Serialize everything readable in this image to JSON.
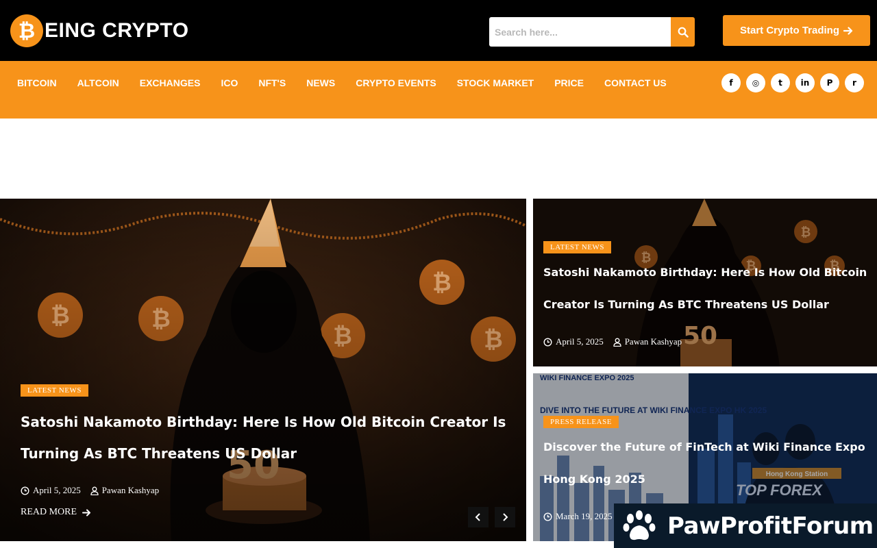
{
  "brand": {
    "logo_mark": "₿",
    "logo_text": "EING CRYPTO"
  },
  "search": {
    "placeholder": "Search here..."
  },
  "cta": {
    "label": "Start Crypto Trading",
    "icon": "arrow-right-icon"
  },
  "nav": {
    "items": [
      "BITCOIN",
      "ALTCOIN",
      "EXCHANGES",
      "ICO",
      "NFT'S",
      "NEWS",
      "CRYPTO EVENTS",
      "STOCK MARKET",
      "PRICE",
      "CONTACT US"
    ]
  },
  "socials": [
    {
      "name": "facebook-icon",
      "glyph": "f"
    },
    {
      "name": "instagram-icon",
      "glyph": "◎"
    },
    {
      "name": "twitter-icon",
      "glyph": "t"
    },
    {
      "name": "linkedin-icon",
      "glyph": "in"
    },
    {
      "name": "pinterest-icon",
      "glyph": "P"
    },
    {
      "name": "reddit-icon",
      "glyph": "r"
    }
  ],
  "featured": {
    "badge": "LATEST NEWS",
    "title": "Satoshi Nakamoto Birthday: Here Is How Old Bitcoin Creator Is Turning As BTC Threatens US Dollar",
    "date": "April 5, 2025",
    "author": "Pawan Kashyap",
    "read_more": "READ MORE",
    "cake_number": "50"
  },
  "side_cards": [
    {
      "badge": "LATEST NEWS",
      "title": "Satoshi Nakamoto Birthday: Here Is How Old Bitcoin Creator Is Turning As BTC Threatens US Dollar",
      "date": "April 5, 2025",
      "author": "Pawan Kashyap"
    },
    {
      "badge": "PRESS RELEASE",
      "title": "Discover the Future of FinTech at Wiki Finance Expo Hong Kong 2025",
      "date": "March 19, 2025",
      "image_texts": {
        "expo_top": "WIKI FINANCE EXPO 2025",
        "dive": "DIVE INTO THE FUTURE AT WIKI FINANCE EXPO HK 2025",
        "top_forex": "TOP FOREX",
        "hk_station": "Hong Kong Station"
      }
    }
  ],
  "watermark": {
    "text": "PawProfitForum"
  },
  "colors": {
    "accent": "#f7931a",
    "topbar": "#000000"
  }
}
